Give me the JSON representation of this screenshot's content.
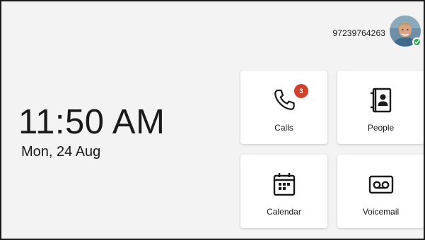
{
  "header": {
    "user_number": "97239764263",
    "avatar_icon": "user-avatar-photo",
    "presence_color": "#2fa84f"
  },
  "clock": {
    "time": "11:50 AM",
    "date": "Mon, 24 Aug"
  },
  "tiles": [
    {
      "label": "Calls",
      "icon": "phone-icon",
      "badge": "3",
      "badge_color": "#d1422c"
    },
    {
      "label": "People",
      "icon": "contacts-icon"
    },
    {
      "label": "Calendar",
      "icon": "calendar-icon"
    },
    {
      "label": "Voicemail",
      "icon": "voicemail-icon"
    }
  ]
}
